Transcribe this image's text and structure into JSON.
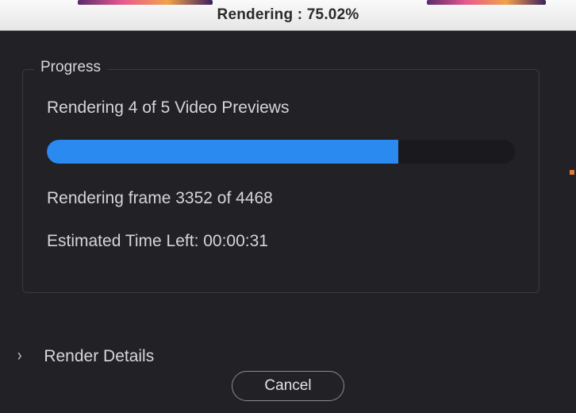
{
  "accent_colors": {
    "primary": "#2a8aef",
    "bg": "#212126",
    "border": "#3a3a40"
  },
  "titlebar": {
    "title": "Rendering : 75.02%"
  },
  "progress": {
    "legend": "Progress",
    "status_text": "Rendering 4 of 5 Video Previews",
    "percent": 75.02,
    "frame_text": "Rendering frame 3352 of 4468",
    "eta_text": "Estimated Time Left: 00:00:31"
  },
  "details": {
    "expanded": false,
    "label": "Render Details"
  },
  "buttons": {
    "cancel": "Cancel"
  }
}
